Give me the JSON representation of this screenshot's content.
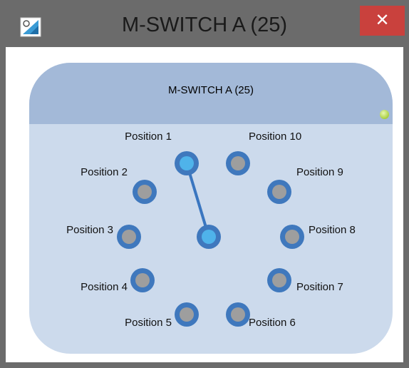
{
  "window": {
    "title": "M-SWITCH A (25)",
    "close_label": "✕",
    "app_icon": "switch-app-icon"
  },
  "panel": {
    "title": "M-SWITCH A (25)",
    "status_led_color": "#a9cf3e",
    "selected_position": "Position 1"
  },
  "positions": [
    {
      "label": "Position 1",
      "selected": true
    },
    {
      "label": "Position 2",
      "selected": false
    },
    {
      "label": "Position 3",
      "selected": false
    },
    {
      "label": "Position 4",
      "selected": false
    },
    {
      "label": "Position 5",
      "selected": false
    },
    {
      "label": "Position 6",
      "selected": false
    },
    {
      "label": "Position 7",
      "selected": false
    },
    {
      "label": "Position 8",
      "selected": false
    },
    {
      "label": "Position 9",
      "selected": false
    },
    {
      "label": "Position 10",
      "selected": false
    }
  ],
  "colors": {
    "knob_ring": "#3f78bd",
    "knob_inactive_fill": "#9e9e9e",
    "knob_active_fill": "#4fb3ea",
    "wiper_line": "#3a76c0"
  }
}
